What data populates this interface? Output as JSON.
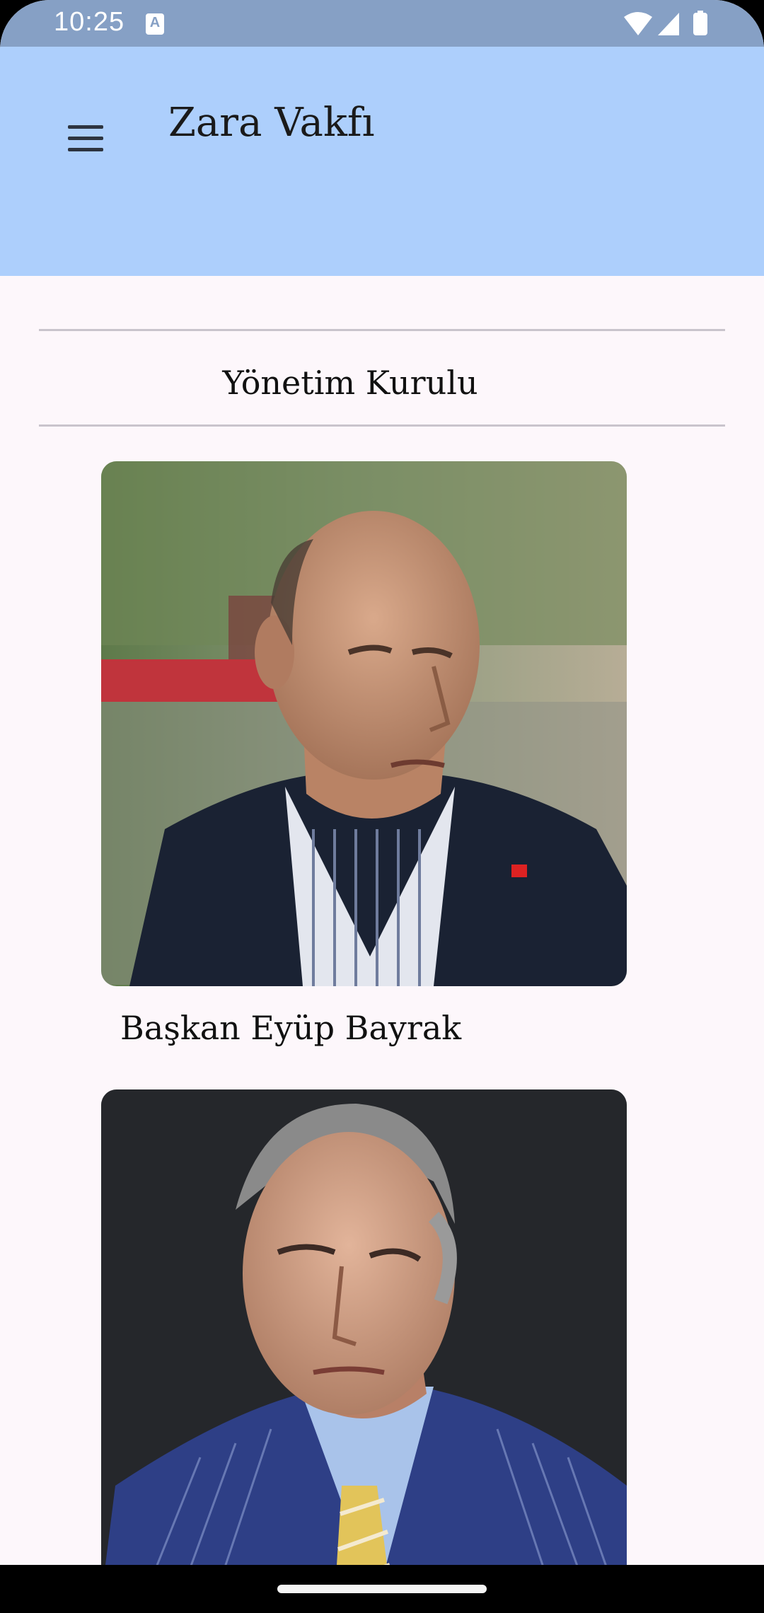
{
  "status_bar": {
    "time": "10:25",
    "notification_icon": "A",
    "icons": [
      "wifi-icon",
      "signal-icon",
      "battery-icon"
    ]
  },
  "app_bar": {
    "title": "Zara Vakfı",
    "menu_icon": "hamburger-menu-icon"
  },
  "section": {
    "title": "Yönetim Kurulu"
  },
  "members": [
    {
      "caption": "Başkan Eyüp Bayrak"
    },
    {
      "caption": ""
    }
  ],
  "colors": {
    "status_bar": "#86a0c5",
    "app_bar": "#adcffc",
    "background": "#fdf7fb",
    "divider": "#c9c4cc"
  }
}
